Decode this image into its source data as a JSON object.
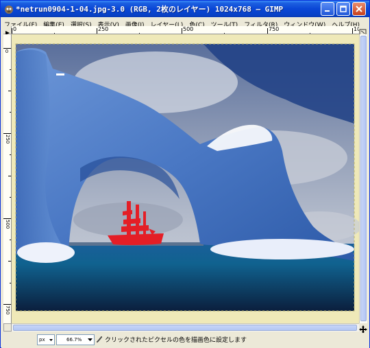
{
  "window": {
    "title": "*netrun0904-1-04.jpg-3.0 (RGB, 2枚のレイヤー) 1024x768 – GIMP"
  },
  "menu": [
    {
      "label": "ファイル(F)"
    },
    {
      "label": "編集(E)"
    },
    {
      "label": "選択(S)"
    },
    {
      "label": "表示(V)"
    },
    {
      "label": "画像(I)"
    },
    {
      "label": "レイヤー(L)"
    },
    {
      "label": "色(C)"
    },
    {
      "label": "ツール(T)"
    },
    {
      "label": "フィルタ(R)"
    },
    {
      "label": "ウィンドウ(W)"
    },
    {
      "label": "ヘルプ(H)"
    }
  ],
  "rulers": {
    "horizontal_ticks": [
      "0",
      "250",
      "500",
      "750",
      "100"
    ],
    "vertical_ticks": [
      "0",
      "250",
      "500",
      "750"
    ]
  },
  "statusbar": {
    "unit": "px",
    "zoom": "66.7%",
    "message": "クリックされたピクセルの色を描画色に設定します"
  },
  "colors": {
    "title_bar": "#0a46d6",
    "selection_red": "#e41e26",
    "canvas_padding": "#efe9b8"
  }
}
